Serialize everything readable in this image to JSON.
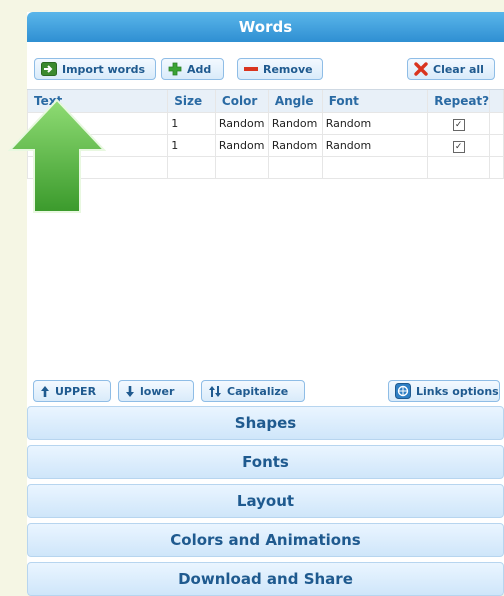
{
  "words_panel": {
    "title": "Words",
    "toolbar": {
      "import_label": "Import words",
      "add_label": "Add",
      "remove_label": "Remove",
      "clear_label": "Clear all"
    },
    "columns": [
      "Text",
      "Size",
      "Color",
      "Angle",
      "Font",
      "Repeat?"
    ],
    "rows": [
      {
        "text": "",
        "size": "1",
        "color": "Random",
        "angle": "Random",
        "font": "Random",
        "repeat": true
      },
      {
        "text": "",
        "size": "1",
        "color": "Random",
        "angle": "Random",
        "font": "Random",
        "repeat": true
      }
    ],
    "bottom_toolbar": {
      "upper_label": "UPPER",
      "lower_label": "lower",
      "capitalize_label": "Capitalize",
      "links_label": "Links options"
    }
  },
  "sections": [
    "Shapes",
    "Fonts",
    "Layout",
    "Colors and Animations",
    "Download and Share"
  ],
  "colors": {
    "header_blue": "#2f8fd2",
    "button_text": "#1f5a8f",
    "arrow_green": "#5cb84a",
    "remove_red": "#d9341f",
    "add_green": "#3aa335"
  },
  "icons": [
    "import-icon",
    "plus-icon",
    "minus-icon",
    "clear-x-icon",
    "up-arrow-icon",
    "down-arrow-icon",
    "updown-arrow-icon",
    "links-icon",
    "green-up-arrow"
  ]
}
